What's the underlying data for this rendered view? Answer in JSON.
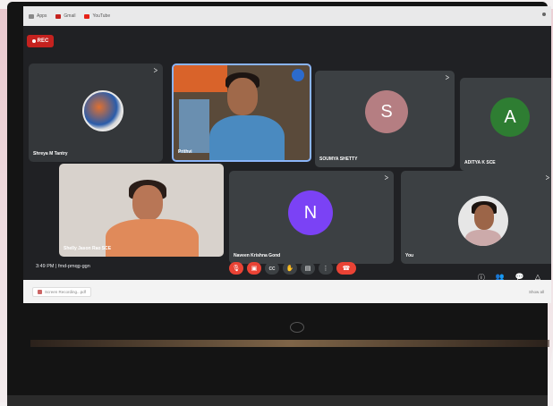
{
  "browser": {
    "bookmarks": [
      {
        "label": "Apps",
        "icon": "apps-icon"
      },
      {
        "label": "Gmail",
        "icon": "gmail-icon"
      },
      {
        "label": "YouTube",
        "icon": "youtube-icon"
      }
    ]
  },
  "meeting": {
    "rec_label": "REC",
    "time": "3:49 PM",
    "separator": "|",
    "meeting_code": "fmd-pmqg-ggn",
    "participants": [
      {
        "name": "Shreya M Tantry"
      },
      {
        "name": "Prithvi"
      },
      {
        "name": "SOUMYA SHETTY",
        "initial": "S",
        "color": "#b57e82"
      },
      {
        "name": "ADITYA K SCE",
        "initial": "A",
        "color": "#2e7d32"
      },
      {
        "name": "Shelly Jason Rao SCE"
      },
      {
        "name": "Naveen Krishna Gond",
        "initial": "N",
        "color": "#7b42f5"
      },
      {
        "name": "You"
      }
    ],
    "controls": [
      {
        "icon": "mic-off-icon",
        "glyph": "🎙"
      },
      {
        "icon": "camera-off-icon",
        "glyph": "▣"
      },
      {
        "icon": "captions-icon",
        "glyph": "cc"
      },
      {
        "icon": "raise-hand-icon",
        "glyph": "✋"
      },
      {
        "icon": "present-icon",
        "glyph": "▤"
      },
      {
        "icon": "more-options-icon",
        "glyph": "⋮"
      },
      {
        "icon": "end-call-icon",
        "glyph": "☎"
      }
    ],
    "right_tools": [
      {
        "icon": "info-icon",
        "glyph": "ⓘ"
      },
      {
        "icon": "people-icon",
        "glyph": "👥"
      },
      {
        "icon": "chat-icon",
        "glyph": "💬"
      },
      {
        "icon": "activities-icon",
        "glyph": "△"
      }
    ]
  },
  "downloads": {
    "item_label": "Screen Recording...pdf",
    "show_all": "Show all"
  }
}
